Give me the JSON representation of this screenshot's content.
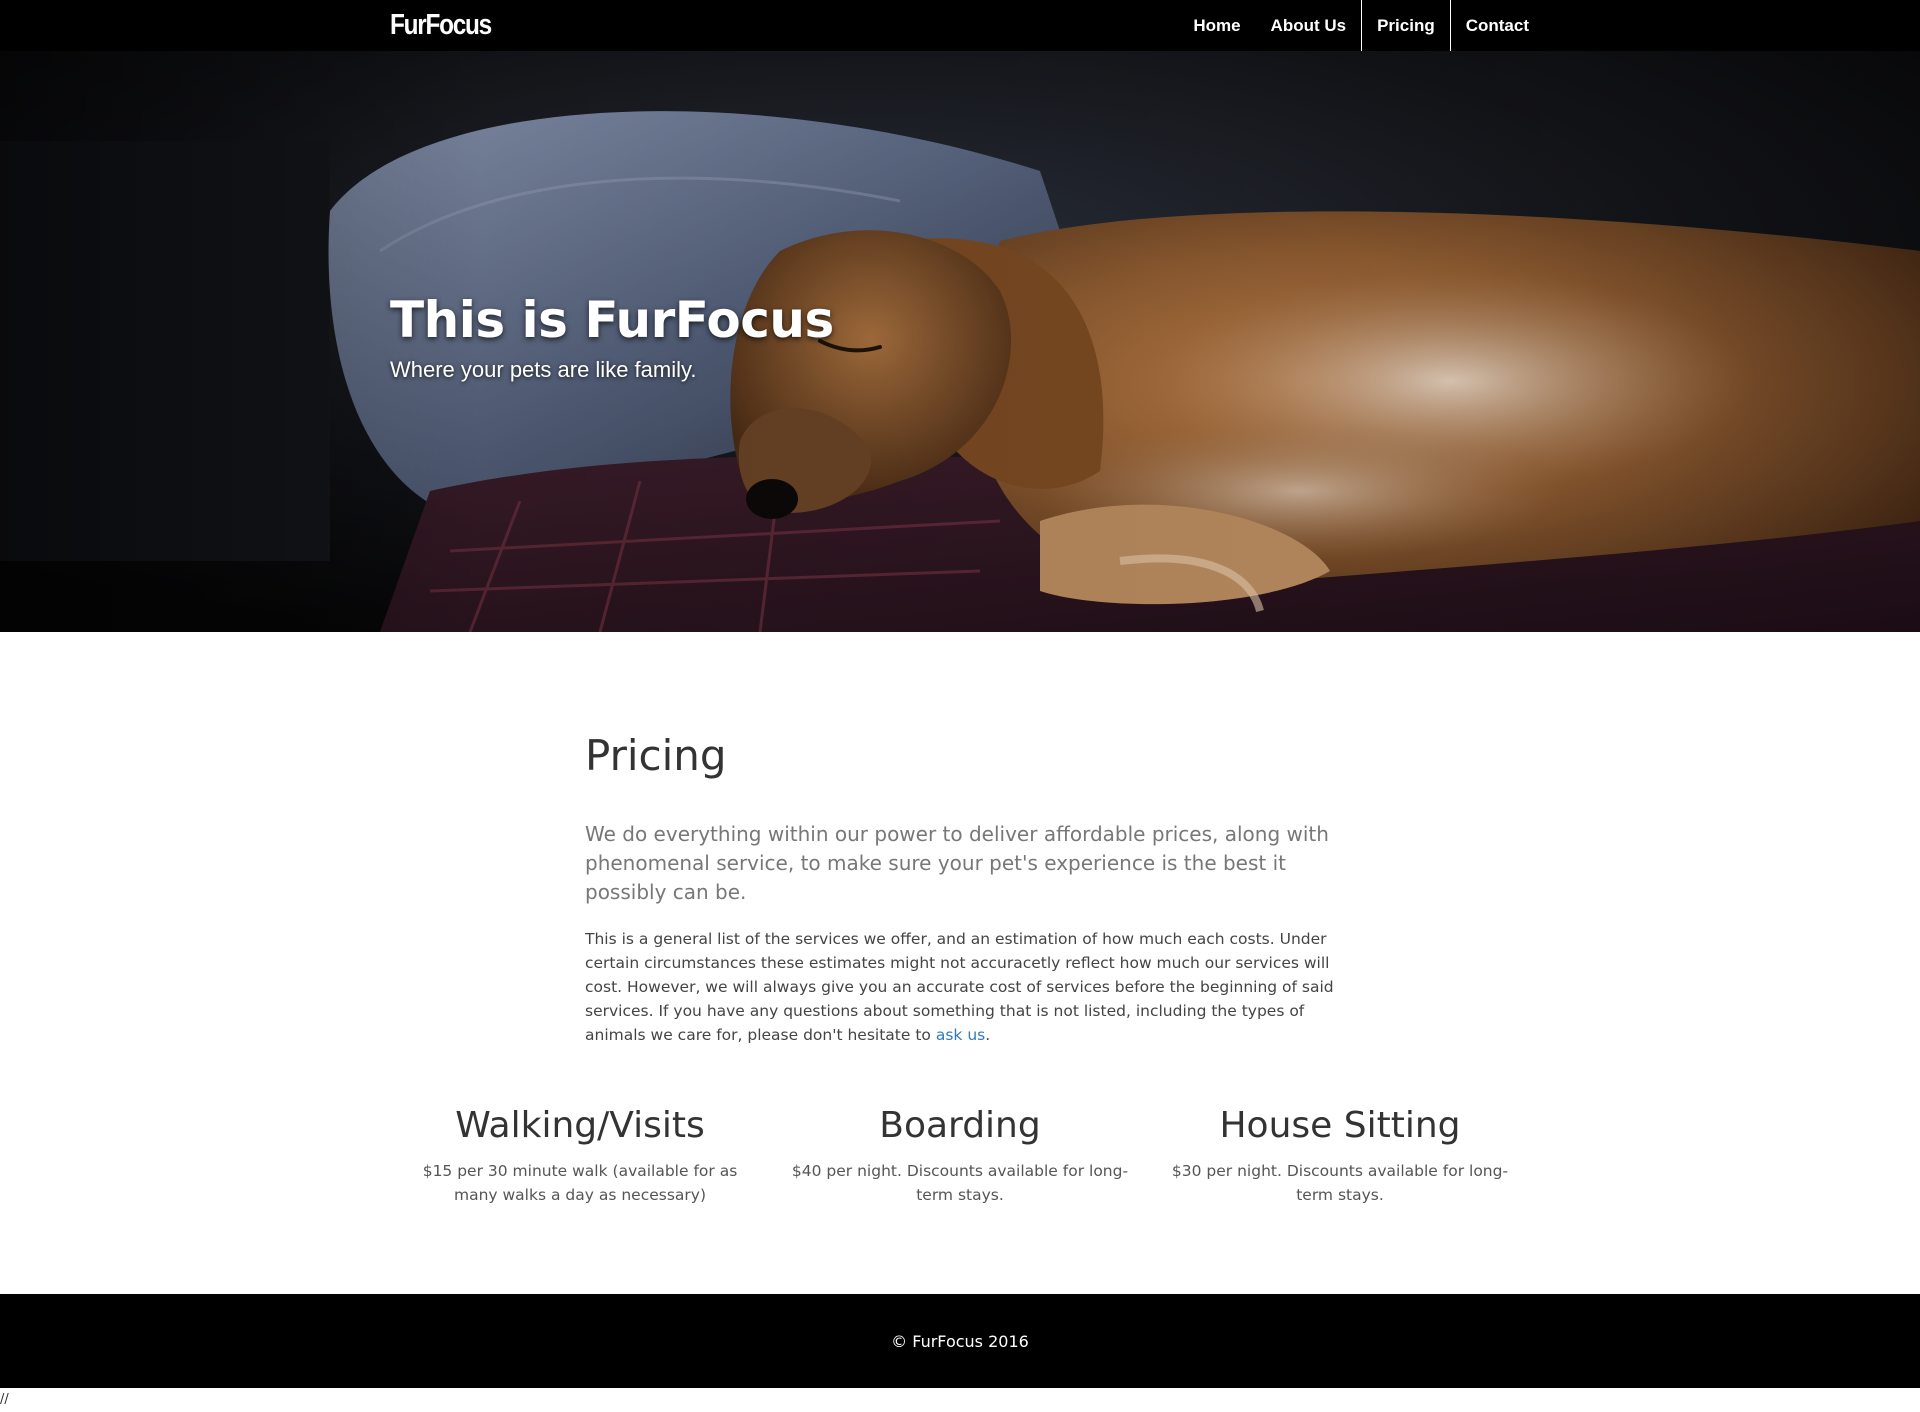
{
  "navbar": {
    "brand": "FurFocus",
    "items": [
      {
        "label": "Home",
        "active": false
      },
      {
        "label": "About Us",
        "active": false
      },
      {
        "label": "Pricing",
        "active": true
      },
      {
        "label": "Contact",
        "active": false
      }
    ]
  },
  "hero": {
    "title": "This is FurFocus",
    "subtitle": "Where your pets are like family."
  },
  "main": {
    "title": "Pricing",
    "lead": "We do everything within our power to deliver affordable prices, along with phenomenal service, to make sure your pet's experience is the best it possibly can be.",
    "body_before_link": "This is a general list of the services we offer, and an estimation of how much each costs. Under certain circumstances these estimates might not accuracetly reflect how much our services will cost. However, we will always give you an accurate cost of services before the beginning of said services. If you have any questions about something that is not listed, including the types of animals we care for, please don't hesitate to ",
    "link_text": "ask us",
    "body_after_link": "."
  },
  "services": [
    {
      "title": "Walking/Visits",
      "description": "$15 per 30 minute walk (available for as many walks a day as necessary)"
    },
    {
      "title": "Boarding",
      "description": "$40 per night. Discounts available for long-term stays."
    },
    {
      "title": "House Sitting",
      "description": "$30 per night. Discounts available for long-term stays."
    }
  ],
  "footer": {
    "copyright": "© FurFocus 2016"
  },
  "stray_text": "//",
  "colors": {
    "navbar_bg": "#000000",
    "footer_bg": "#000000",
    "link": "#337ab7",
    "heading": "#333333",
    "lead": "#777777"
  }
}
